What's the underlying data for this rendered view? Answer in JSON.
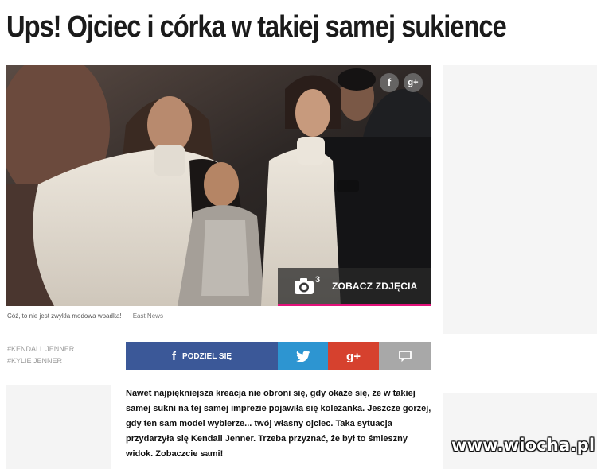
{
  "headline": "Ups! Ojciec i córka w takiej samej sukience",
  "photo": {
    "share_facebook": "f",
    "share_google": "g+",
    "gallery_count": "3",
    "gallery_label": "ZOBACZ ZDJĘCIA"
  },
  "caption": {
    "text": "Cóż, to nie jest zwykła modowa wpadka!",
    "separator": "|",
    "source": "East News"
  },
  "tags": [
    "#KENDALL JENNER",
    "#KYLIE JENNER"
  ],
  "share_bar": {
    "facebook_icon": "f",
    "facebook_label": "PODZIEL SIĘ",
    "google_label": "g+"
  },
  "article": {
    "text": "Nawet najpiękniejsza kreacja nie obroni się, gdy okaże się, że w takiej samej sukni na tej samej imprezie pojawiła się koleżanka. Jeszcze gorzej, gdy ten sam model wybierze... twój własny ojciec. Taka sytuacja przydarzyła się Kendall Jenner. Trzeba przyznać, że był to śmieszny widok. Zobaczcie sami!"
  },
  "watermark": "www.wiocha.pl",
  "colors": {
    "accent": "#e2117a",
    "facebook": "#3b5898",
    "twitter": "#2d95d1",
    "google": "#d6412e",
    "comment": "#a8a8a8"
  }
}
